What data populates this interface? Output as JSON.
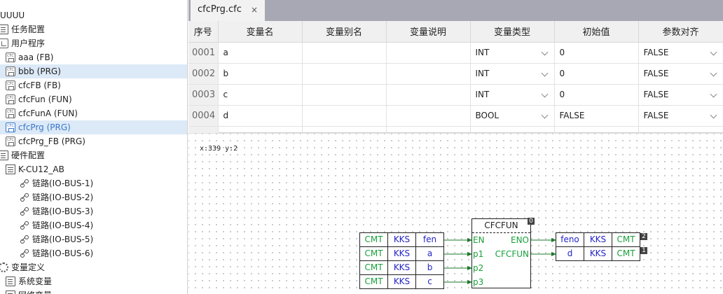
{
  "tree": [
    {
      "label": "UUUU",
      "indent": 0,
      "icon": "none"
    },
    {
      "label": "任务配置",
      "indent": 1,
      "icon": "document-icon"
    },
    {
      "label": "用户程序",
      "indent": 1,
      "icon": "folder-icon"
    },
    {
      "label": "aaa (FB)",
      "indent": 2,
      "icon": "cfc-icon"
    },
    {
      "label": "bbb (PRG)",
      "indent": 2,
      "icon": "cfc-icon",
      "state": "hover"
    },
    {
      "label": "cfcFB (FB)",
      "indent": 2,
      "icon": "cfc-icon"
    },
    {
      "label": "cfcFun (FUN)",
      "indent": 2,
      "icon": "cfc-icon"
    },
    {
      "label": "cfcFunA (FUN)",
      "indent": 2,
      "icon": "cfc-icon"
    },
    {
      "label": "cfcPrg (PRG)",
      "indent": 2,
      "icon": "cfc-icon",
      "state": "selected"
    },
    {
      "label": "cfcPrg_FB (PRG)",
      "indent": 2,
      "icon": "cfc-icon"
    },
    {
      "label": "硬件配置",
      "indent": 1,
      "icon": "document-icon"
    },
    {
      "label": "K-CU12_AB",
      "indent": 2,
      "icon": "hardware-icon"
    },
    {
      "label": "链路(IO-BUS-1)",
      "indent": 3,
      "icon": "link-icon"
    },
    {
      "label": "链路(IO-BUS-2)",
      "indent": 3,
      "icon": "link-icon"
    },
    {
      "label": "链路(IO-BUS-3)",
      "indent": 3,
      "icon": "link-icon"
    },
    {
      "label": "链路(IO-BUS-4)",
      "indent": 3,
      "icon": "link-icon"
    },
    {
      "label": "链路(IO-BUS-5)",
      "indent": 3,
      "icon": "link-icon"
    },
    {
      "label": "链路(IO-BUS-6)",
      "indent": 3,
      "icon": "link-icon"
    },
    {
      "label": "变量定义",
      "indent": 1,
      "icon": "gear-icon"
    },
    {
      "label": "系统变量",
      "indent": 2,
      "icon": "document-icon"
    },
    {
      "label": "网络变量",
      "indent": 2,
      "icon": "document-icon"
    }
  ],
  "tab": {
    "label": "cfcPrg.cfc",
    "close": "×"
  },
  "table": {
    "headers": [
      "序号",
      "变量名",
      "变量别名",
      "变量说明",
      "变量类型",
      "初始值",
      "参数对齐"
    ],
    "rows": [
      {
        "num": "0001",
        "name": "a",
        "alias": "",
        "desc": "",
        "type": "INT",
        "init": "0",
        "align": "FALSE"
      },
      {
        "num": "0002",
        "name": "b",
        "alias": "",
        "desc": "",
        "type": "INT",
        "init": "0",
        "align": "FALSE"
      },
      {
        "num": "0003",
        "name": "c",
        "alias": "",
        "desc": "",
        "type": "INT",
        "init": "0",
        "align": "FALSE"
      },
      {
        "num": "0004",
        "name": "d",
        "alias": "",
        "desc": "",
        "type": "BOOL",
        "init": "FALSE",
        "align": "FALSE"
      }
    ]
  },
  "canvas": {
    "coord": "x:339 y:2",
    "inputs": [
      {
        "cmt": "CMT",
        "kks": "KKS",
        "var": "fen"
      },
      {
        "cmt": "CMT",
        "kks": "KKS",
        "var": "a"
      },
      {
        "cmt": "CMT",
        "kks": "KKS",
        "var": "b"
      },
      {
        "cmt": "CMT",
        "kks": "KKS",
        "var": "c"
      }
    ],
    "block": {
      "title": "CFCFUN",
      "order": "0",
      "in_pins": [
        "EN",
        "p1",
        "p2",
        "p3"
      ],
      "out_pins": [
        "ENO",
        "CFCFUN"
      ]
    },
    "outputs": [
      {
        "var": "feno",
        "kks": "KKS",
        "cmt": "CMT",
        "order": "2"
      },
      {
        "var": "d",
        "kks": "KKS",
        "cmt": "CMT",
        "order": "1"
      }
    ],
    "colors": {
      "comment": "#19a03c",
      "variable": "#2424c8",
      "wire": "#1a7a2a"
    }
  }
}
